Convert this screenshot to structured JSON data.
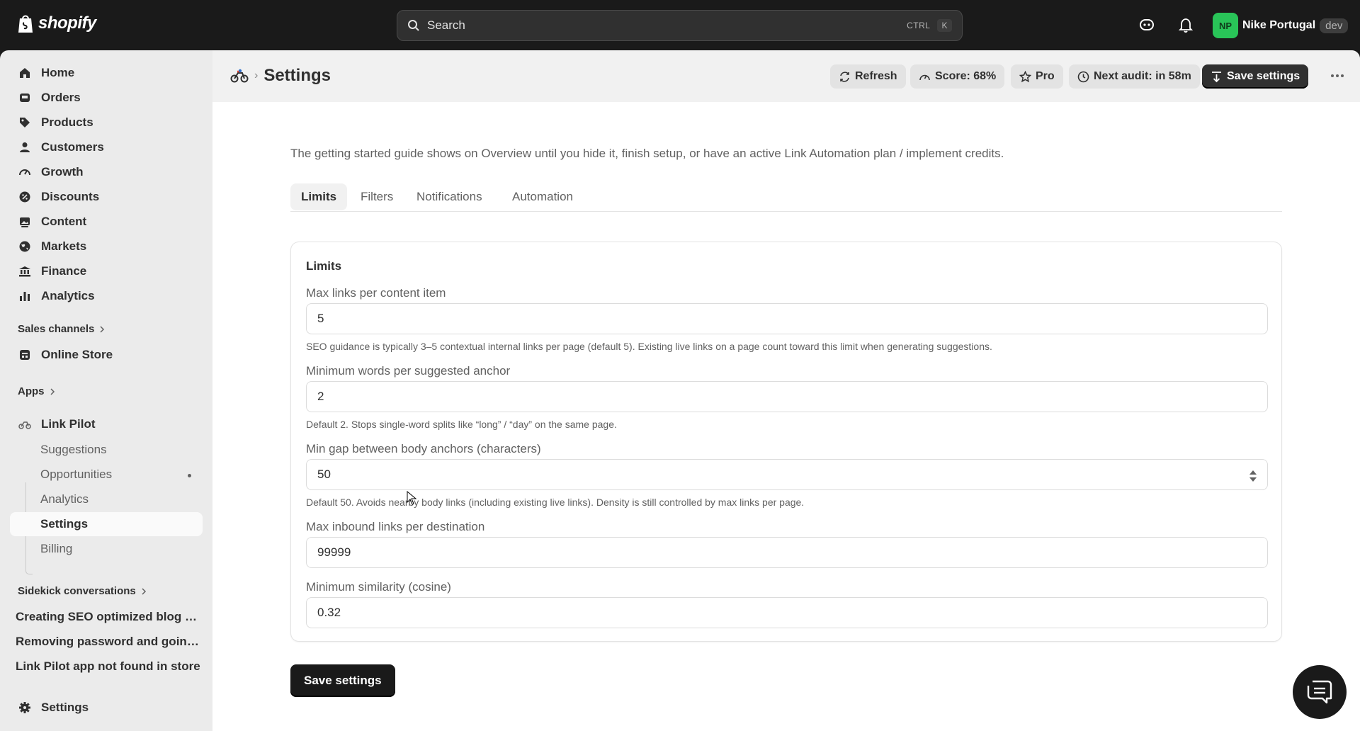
{
  "topbar": {
    "brand": "shopify",
    "search_placeholder": "Search",
    "shortcut_ctrl": "CTRL",
    "shortcut_key": "K",
    "user_initials": "NP",
    "user_name": "Nike Portugal",
    "env_badge": "dev",
    "avatar_color": "#29c458"
  },
  "sidebar": {
    "items": [
      {
        "label": "Home",
        "icon": "home-icon"
      },
      {
        "label": "Orders",
        "icon": "inbox-icon"
      },
      {
        "label": "Products",
        "icon": "tag-icon"
      },
      {
        "label": "Customers",
        "icon": "person-icon"
      },
      {
        "label": "Growth",
        "icon": "gauge-icon"
      },
      {
        "label": "Discounts",
        "icon": "discount-icon"
      },
      {
        "label": "Content",
        "icon": "image-icon"
      },
      {
        "label": "Markets",
        "icon": "globe-icon"
      },
      {
        "label": "Finance",
        "icon": "bank-icon"
      },
      {
        "label": "Analytics",
        "icon": "bar-chart-icon"
      }
    ],
    "sales_channels": "Sales channels",
    "online_store": "Online Store",
    "apps": "Apps",
    "app_name": "Link Pilot",
    "app_subitems": [
      "Suggestions",
      "Opportunities",
      "Analytics",
      "Settings",
      "Billing"
    ],
    "active_subitem": "Settings",
    "sidekick": "Sidekick conversations",
    "conversations": [
      "Creating SEO optimized blog p...",
      "Removing password and going...",
      "Link Pilot app not found in store"
    ],
    "settings": "Settings"
  },
  "header": {
    "title": "Settings",
    "buttons": {
      "refresh": "Refresh",
      "score": "Score: 68%",
      "pro": "Pro",
      "next_audit": "Next audit: in 58m",
      "save": "Save settings"
    }
  },
  "main": {
    "intro": "The getting started guide shows on Overview until you hide it, finish setup, or have an active Link Automation plan / implement credits.",
    "tabs": [
      "Limits",
      "Filters",
      "Notifications",
      "Automation"
    ],
    "active_tab": "Limits",
    "card": {
      "title": "Limits",
      "fields": [
        {
          "label": "Max links per content item",
          "value": "5",
          "help": "SEO guidance is typically 3–5 contextual internal links per page (default 5). Existing live links on a page count toward this limit when generating suggestions."
        },
        {
          "label": "Minimum words per suggested anchor",
          "value": "2",
          "help": "Default 2. Stops single-word splits like “long” / “day” on the same page."
        },
        {
          "label": "Min gap between body anchors (characters)",
          "value": "50",
          "help": "Default 50. Avoids nearby body links (including existing live links). Density is still controlled by max links per page."
        },
        {
          "label": "Max inbound links per destination",
          "value": "99999",
          "help": ""
        },
        {
          "label": "Minimum similarity (cosine)",
          "value": "0.32",
          "help": ""
        }
      ]
    },
    "save_label": "Save settings"
  }
}
